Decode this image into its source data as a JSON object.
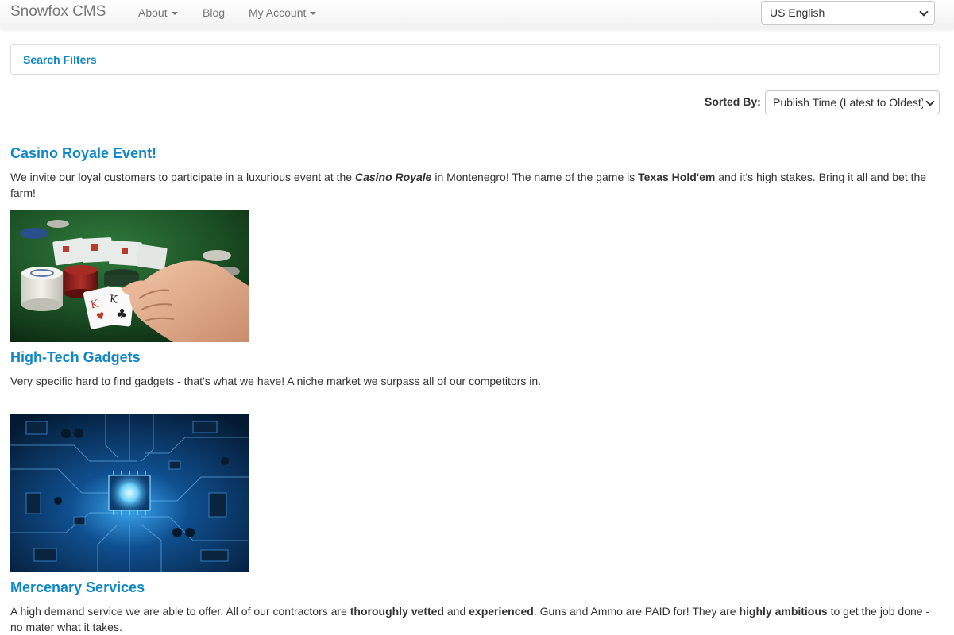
{
  "navbar": {
    "brand": "Snowfox CMS",
    "items": [
      {
        "label": "About",
        "dropdown": true
      },
      {
        "label": "Blog",
        "dropdown": false
      },
      {
        "label": "My Account",
        "dropdown": true
      }
    ],
    "language": {
      "selected": "US English"
    }
  },
  "filters": {
    "label": "Search Filters"
  },
  "sort": {
    "label": "Sorted By:",
    "selected": "Publish Time (Latest to Oldest)"
  },
  "posts": [
    {
      "title": "Casino Royale Event!",
      "body": [
        {
          "text": "We invite our loyal customers to participate in a luxurious event at the ",
          "style": "normal"
        },
        {
          "text": "Casino Royale",
          "style": "bold-italic"
        },
        {
          "text": " in Montenegro! The name of the game is ",
          "style": "normal"
        },
        {
          "text": "Texas Hold'em",
          "style": "bold"
        },
        {
          "text": " and it's high stakes. Bring it all and bet the farm!",
          "style": "normal"
        }
      ],
      "image": "poker-cards-chips"
    },
    {
      "title": "High-Tech Gadgets",
      "body": [
        {
          "text": "Very specific hard to find gadgets - that's what we have! A niche market we surpass all of our competitors in.",
          "style": "normal"
        }
      ],
      "image": "circuit-board"
    },
    {
      "title": "Mercenary Services",
      "body": [
        {
          "text": "A high demand service we are able to offer. All of our contractors are ",
          "style": "normal"
        },
        {
          "text": "thoroughly vetted",
          "style": "bold"
        },
        {
          "text": " and ",
          "style": "normal"
        },
        {
          "text": "experienced",
          "style": "bold"
        },
        {
          "text": ". Guns and Ammo are PAID for! They are ",
          "style": "normal"
        },
        {
          "text": "highly ambitious",
          "style": "bold"
        },
        {
          "text": " to get the job done - no mater what it takes.",
          "style": "normal"
        }
      ]
    }
  ],
  "colors": {
    "link": "#0e87c6",
    "text": "#333333",
    "muted": "#777777",
    "border": "#dddddd"
  }
}
